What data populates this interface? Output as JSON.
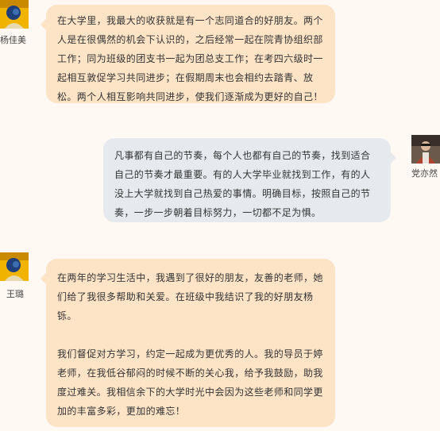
{
  "messages": [
    {
      "sender": "杨佳美",
      "side": "left",
      "avatar_icon": "yellow-portrait-avatar",
      "paragraphs": [
        "在大学里，我最大的收获就是有一个志同道合的好朋友。两个人是在很偶然的机会下认识的，之后经常一起在院青协组织部工作；同为班级的团支书一起为团总支工作；在考四六级时一起相互敦促学习共同进步；在假期周末也会相约去踏青、放松。两个人相互影响共同进步，使我们逐渐成为更好的自己！"
      ]
    },
    {
      "sender": "党亦然",
      "side": "right",
      "avatar_icon": "person-photo-avatar",
      "paragraphs": [
        "凡事都有自己的节奏，每个人也都有自己的节奏，找到适合自己的节奏才最重要。有的人大学毕业就找到工作，有的人没上大学就找到自己热爱的事情。明确目标，按照自己的节奏，一步一步朝着目标努力，一切都不足为惧。"
      ]
    },
    {
      "sender": "王璐",
      "side": "left",
      "avatar_icon": "yellow-portrait-avatar",
      "paragraphs": [
        "在两年的学习生活中，我遇到了很好的朋友，友善的老师，她们给了我很多帮助和关爱。在班级中我结识了我的好朋友杨铄。",
        "我们督促对方学习，约定一起成为更优秀的人。我的导员于婷老师，在我低谷郁闷的时候不断的关心我，给予我鼓励，助我度过难关。我相信余下的大学时光中会因为这些老师和同学更加的丰富多彩，更加的难忘！"
      ]
    }
  ]
}
